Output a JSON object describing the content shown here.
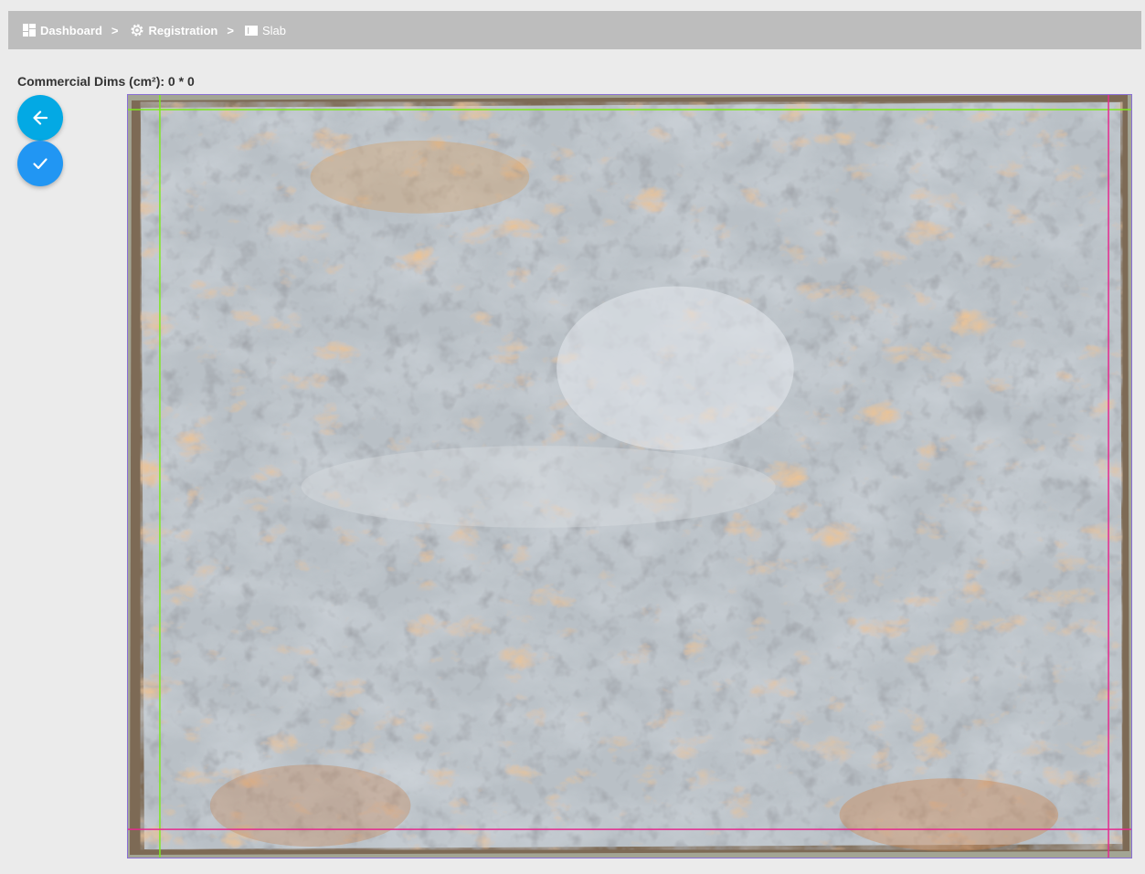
{
  "breadcrumb": {
    "items": [
      {
        "label": "Dashboard",
        "icon": "dashboard-icon"
      },
      {
        "label": "Registration",
        "icon": "gear-icon"
      },
      {
        "label": "Slab",
        "icon": "slab-icon"
      }
    ],
    "separator": ">"
  },
  "dims": {
    "label": "Commercial Dims (cm²): 0 * 0"
  },
  "actions": {
    "back_icon": "arrow-left-icon",
    "confirm_icon": "check-icon"
  },
  "colors": {
    "breadcrumb_bg": "#bdbdbd",
    "back_button": "#03a9e4",
    "confirm_button": "#2196f3",
    "guide_green": "#7ee81f",
    "guide_magenta": "#e52a8f",
    "frame_border": "#8a6fd6"
  },
  "image": {
    "alt": "Marble slab photo"
  }
}
